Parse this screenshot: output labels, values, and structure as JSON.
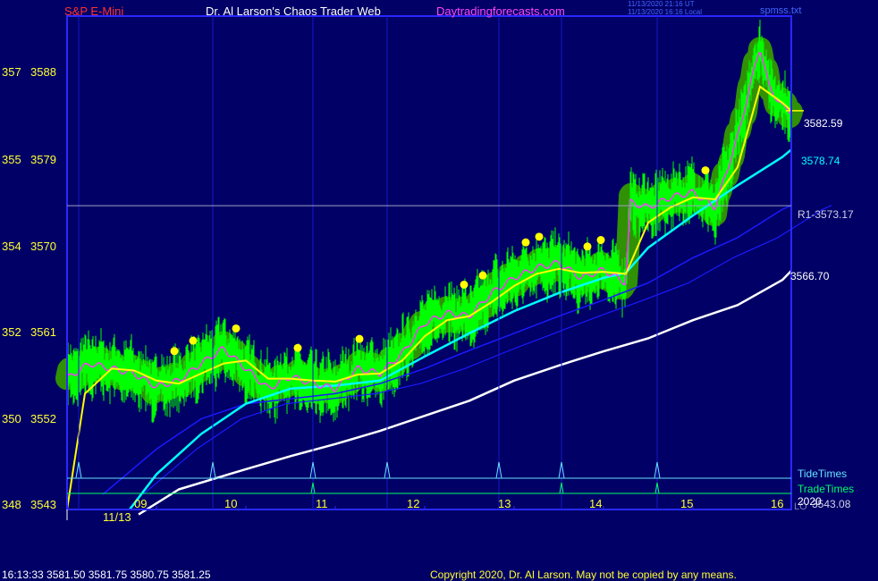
{
  "header": {
    "symbol": "S&P E-Mini",
    "author_title": "Dr. Al Larson's Chaos Trader Web",
    "site": "Daytradingforecasts.com",
    "stamp_utc": "11/13/2020 21:16 UT",
    "stamp_local": "11/13/2020 16:16 Local",
    "file": "spmss.txt"
  },
  "footer": {
    "quote": "16:13:33  3581.50 3581.75 3580.75 3581.25",
    "copyright": "Copyright 2020, Dr. Al Larson. May not be copied by any means."
  },
  "colors": {
    "background": "#000066",
    "frame": "#2828ff",
    "price_bars": "#00ff00",
    "halo": "#339900",
    "fast_line": "#ff33ff",
    "slow_line": "#ffff00",
    "cyan_line": "#00ffff",
    "blue_line": "#1a1aff",
    "white_line": "#ffffff",
    "r1_line": "#a0a0c8",
    "tide_times": "#66e0ff",
    "trade_times": "#00ff66"
  },
  "chart_data": {
    "type": "line",
    "title": "S&P E-Mini",
    "date_label": "11/13",
    "x_hour_ticks": [
      "09",
      "10",
      "11",
      "12",
      "13",
      "14",
      "15",
      "16"
    ],
    "x_range_hours": [
      8.0,
      16.1
    ],
    "y_range": [
      3543,
      3592
    ],
    "y_ticks": [
      {
        "left": "348",
        "right": "3543",
        "price": 3543
      },
      {
        "left": "350",
        "right": "3552",
        "price": 3552
      },
      {
        "left": "352",
        "right": "3561",
        "price": 3561
      },
      {
        "left": "354",
        "right": "3570",
        "price": 3570
      },
      {
        "left": "355",
        "right": "3579",
        "price": 3579
      },
      {
        "left": "357",
        "right": "3588",
        "price": 3588
      }
    ],
    "price_labels": [
      {
        "text": "3582.59",
        "price": 3582.59,
        "color": "#ffffff"
      },
      {
        "text": "3578.74",
        "price": 3578.74,
        "color": "#00ffff"
      },
      {
        "text": "R1-3573.17",
        "price": 3573.17,
        "color": "#d0d0e8"
      },
      {
        "text": "3566.70",
        "price": 3566.7,
        "color": "#ffffff"
      },
      {
        "text": "3543.08",
        "price": 3543.08,
        "color": "#d0d0e8"
      }
    ],
    "r1_level": 3573.17,
    "lower_labels": {
      "tide": "TideTimes",
      "trade": "TradeTimes",
      "year": "2020",
      "left_label": "LO"
    },
    "tide_time_spikes": [
      8.13,
      9.63,
      10.75,
      11.58,
      12.83,
      13.53,
      14.6
    ],
    "trade_time_spikes": [
      10.75,
      13.53,
      14.6
    ],
    "series": [
      {
        "name": "Price",
        "points": [
          [
            8.0,
            3556.0
          ],
          [
            8.25,
            3557.5
          ],
          [
            8.5,
            3557.0
          ],
          [
            8.75,
            3556.5
          ],
          [
            9.0,
            3555.2
          ],
          [
            9.25,
            3555.8
          ],
          [
            9.5,
            3557.5
          ],
          [
            9.75,
            3559.0
          ],
          [
            10.0,
            3557.0
          ],
          [
            10.25,
            3555.0
          ],
          [
            10.5,
            3556.2
          ],
          [
            10.75,
            3555.5
          ],
          [
            11.0,
            3555.0
          ],
          [
            11.25,
            3557.0
          ],
          [
            11.5,
            3556.5
          ],
          [
            11.75,
            3558.5
          ],
          [
            12.0,
            3561.5
          ],
          [
            12.25,
            3562.5
          ],
          [
            12.5,
            3562.2
          ],
          [
            12.75,
            3564.5
          ],
          [
            13.0,
            3566.0
          ],
          [
            13.25,
            3567.0
          ],
          [
            13.5,
            3567.5
          ],
          [
            13.75,
            3566.0
          ],
          [
            14.0,
            3566.8
          ],
          [
            14.25,
            3565.5
          ],
          [
            14.3,
            3573.5
          ],
          [
            14.5,
            3573.0
          ],
          [
            14.75,
            3574.0
          ],
          [
            15.0,
            3574.5
          ],
          [
            15.25,
            3573.0
          ],
          [
            15.5,
            3580.0
          ],
          [
            15.75,
            3589.0
          ],
          [
            15.85,
            3585.0
          ],
          [
            16.0,
            3583.0
          ],
          [
            16.1,
            3582.6
          ]
        ]
      },
      {
        "name": "Slow average",
        "points": [
          [
            8.0,
            3543.0
          ],
          [
            8.2,
            3554.5
          ],
          [
            8.5,
            3557.0
          ],
          [
            8.75,
            3556.8
          ],
          [
            9.0,
            3555.8
          ],
          [
            9.25,
            3555.5
          ],
          [
            9.5,
            3556.5
          ],
          [
            9.75,
            3557.5
          ],
          [
            10.0,
            3557.8
          ],
          [
            10.25,
            3556.0
          ],
          [
            10.5,
            3556.0
          ],
          [
            10.75,
            3555.8
          ],
          [
            11.0,
            3555.7
          ],
          [
            11.25,
            3556.4
          ],
          [
            11.5,
            3556.5
          ],
          [
            11.75,
            3557.8
          ],
          [
            12.0,
            3560.2
          ],
          [
            12.25,
            3561.8
          ],
          [
            12.5,
            3562.2
          ],
          [
            12.75,
            3563.6
          ],
          [
            13.0,
            3565.2
          ],
          [
            13.25,
            3566.4
          ],
          [
            13.5,
            3566.9
          ],
          [
            13.75,
            3566.5
          ],
          [
            14.0,
            3566.6
          ],
          [
            14.25,
            3566.4
          ],
          [
            14.5,
            3571.5
          ],
          [
            14.75,
            3573.0
          ],
          [
            15.0,
            3574.0
          ],
          [
            15.25,
            3573.8
          ],
          [
            15.5,
            3577.0
          ],
          [
            15.75,
            3585.0
          ],
          [
            16.0,
            3583.4
          ],
          [
            16.1,
            3582.6
          ]
        ]
      },
      {
        "name": "Cyan average",
        "points": [
          [
            8.7,
            3543.0
          ],
          [
            9.0,
            3546.5
          ],
          [
            9.5,
            3550.5
          ],
          [
            10.0,
            3553.5
          ],
          [
            10.5,
            3555.0
          ],
          [
            11.0,
            3555.3
          ],
          [
            11.5,
            3555.8
          ],
          [
            12.0,
            3558.2
          ],
          [
            12.5,
            3560.5
          ],
          [
            13.0,
            3562.7
          ],
          [
            13.5,
            3564.5
          ],
          [
            14.0,
            3566.0
          ],
          [
            14.25,
            3566.5
          ],
          [
            14.5,
            3569.0
          ],
          [
            15.0,
            3572.2
          ],
          [
            15.5,
            3575.2
          ],
          [
            16.0,
            3578.0
          ],
          [
            16.1,
            3578.74
          ]
        ]
      },
      {
        "name": "Blue average",
        "points": [
          [
            8.4,
            3544.5
          ],
          [
            9.0,
            3549.0
          ],
          [
            9.5,
            3552.0
          ],
          [
            10.0,
            3553.5
          ],
          [
            10.5,
            3554.0
          ],
          [
            11.0,
            3554.5
          ],
          [
            11.5,
            3555.5
          ],
          [
            12.0,
            3557.0
          ],
          [
            12.5,
            3558.8
          ],
          [
            13.0,
            3560.5
          ],
          [
            13.5,
            3562.2
          ],
          [
            14.0,
            3563.8
          ],
          [
            14.5,
            3565.5
          ],
          [
            15.0,
            3568.0
          ],
          [
            15.5,
            3570.0
          ],
          [
            16.0,
            3572.8
          ],
          [
            16.1,
            3573.2
          ]
        ]
      },
      {
        "name": "White average",
        "points": [
          [
            8.8,
            3542.5
          ],
          [
            9.25,
            3545.0
          ],
          [
            10.0,
            3547.0
          ],
          [
            10.5,
            3548.3
          ],
          [
            11.0,
            3549.5
          ],
          [
            11.5,
            3550.8
          ],
          [
            12.0,
            3552.3
          ],
          [
            12.5,
            3553.8
          ],
          [
            13.0,
            3555.8
          ],
          [
            13.5,
            3557.3
          ],
          [
            14.0,
            3558.7
          ],
          [
            14.5,
            3560.0
          ],
          [
            15.0,
            3561.8
          ],
          [
            15.5,
            3563.3
          ],
          [
            16.0,
            3565.8
          ],
          [
            16.1,
            3566.7
          ]
        ]
      }
    ]
  }
}
